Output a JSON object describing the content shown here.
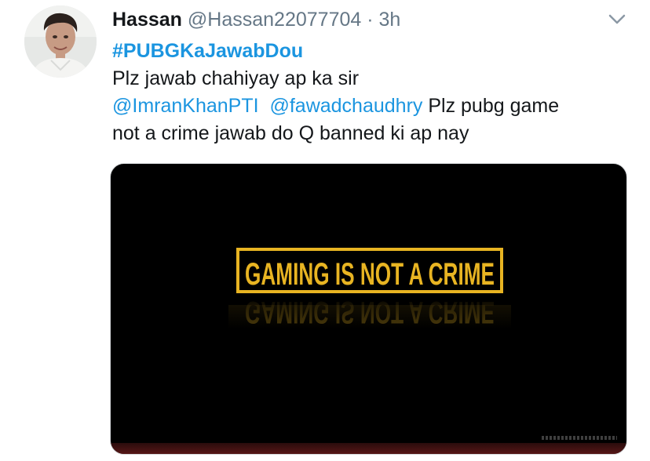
{
  "tweet": {
    "display_name": "Hassan",
    "handle": "@Hassan22077704",
    "separator": "·",
    "time": "3h",
    "hashtag": "#PUBGKaJawabDou",
    "line1": "Plz jawab chahiyay ap ka sir",
    "mention1": "@ImranKhanPTI",
    "mention2": "@fawadchaudhry",
    "line2_rest": " Plz pubg game",
    "line3": "not a crime jawab do Q banned ki ap nay"
  },
  "media": {
    "banner_text": "GAMING IS NOT A CRIME",
    "banner_color": "#e8b422"
  },
  "colors": {
    "link": "#1b95e0",
    "secondary": "#657786",
    "text": "#14171a"
  },
  "icons": {
    "caret": "chevron-down-icon",
    "avatar": "user-avatar"
  }
}
